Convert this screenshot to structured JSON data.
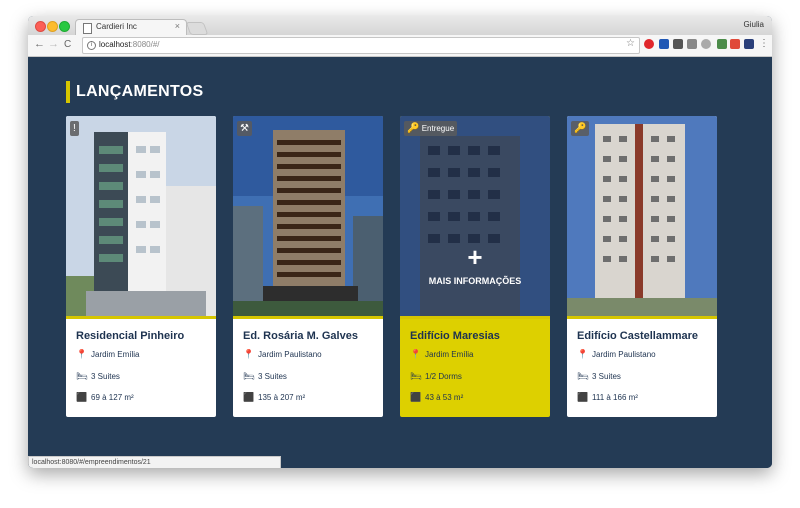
{
  "browser": {
    "tab_title": "Cardieri Inc",
    "tab_close": "×",
    "user": "Giulia",
    "url_host": "localhost",
    "url_path": ":8080/#/",
    "nav_back": "←",
    "nav_forward": "→",
    "nav_reload": "C",
    "star": "☆"
  },
  "page": {
    "heading": "LANÇAMENTOS",
    "overlay_plus": "+",
    "overlay_more": "MAIS INFORMAÇÕES",
    "cards": [
      {
        "title": "Residencial Pinheiro",
        "neighborhood": "Jardim Emília",
        "suites": "3 Suites",
        "area": "69 à 127 m²",
        "badge_icon": "!",
        "badge_text": ""
      },
      {
        "title": "Ed. Rosária M. Galves",
        "neighborhood": "Jardim Paulistano",
        "suites": "3 Suites",
        "area": "135 à 207 m²",
        "badge_icon": "⚒",
        "badge_text": ""
      },
      {
        "title": "Edifício Maresias",
        "neighborhood": "Jardim Emília",
        "suites": "1/2 Dorms",
        "area": "43 à 53 m²",
        "badge_icon": "🔑",
        "badge_text": "Entregue"
      },
      {
        "title": "Edifício Castellammare",
        "neighborhood": "Jardim Paulistano",
        "suites": "3 Suites",
        "area": "111 à 166 m²",
        "badge_icon": "🔑",
        "badge_text": ""
      }
    ]
  },
  "status_url": "localhost:8080/#/empreendimentos/21",
  "colors": {
    "accent": "#d6c600",
    "navy": "#243b55",
    "active_card": "#ddd000"
  }
}
